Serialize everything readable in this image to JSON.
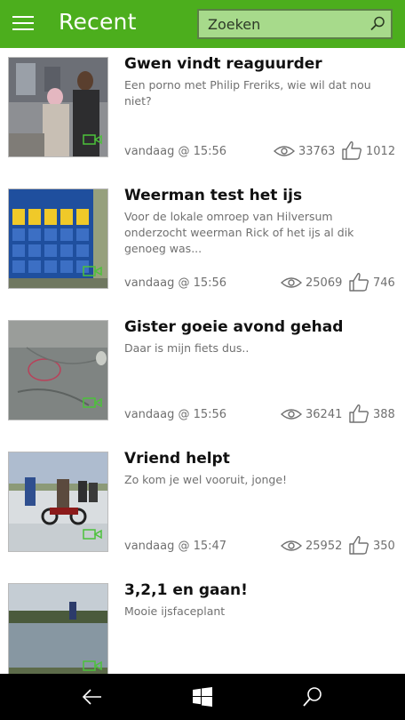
{
  "header": {
    "title": "Recent",
    "search_placeholder": "Zoeken",
    "menu_icon": "hamburger-icon",
    "search_icon": "search-icon",
    "accent_color": "#4cae1d"
  },
  "items": [
    {
      "title": "Gwen vindt reaguurder",
      "description": "Een porno met Philip Freriks, wie wil dat nou niet?",
      "date": "vandaag @ 15:56",
      "views": "33763",
      "likes": "1012"
    },
    {
      "title": "Weerman test het ijs",
      "description": "Voor de lokale omroep van Hilversum onderzocht weerman Rick of het ijs al dik genoeg was...",
      "date": "vandaag @ 15:56",
      "views": "25069",
      "likes": "746"
    },
    {
      "title": "Gister goeie avond gehad",
      "description": "Daar is mijn fiets dus..",
      "date": "vandaag @ 15:56",
      "views": "36241",
      "likes": "388"
    },
    {
      "title": "Vriend helpt",
      "description": "Zo kom je wel vooruit, jonge!",
      "date": "vandaag @ 15:47",
      "views": "25952",
      "likes": "350"
    },
    {
      "title": "3,2,1 en gaan!",
      "description": "Mooie ijsfaceplant",
      "date": "",
      "views": "",
      "likes": ""
    }
  ],
  "bottom_nav": {
    "back_icon": "back-arrow-icon",
    "home_icon": "windows-logo-icon",
    "search_icon": "search-icon"
  }
}
